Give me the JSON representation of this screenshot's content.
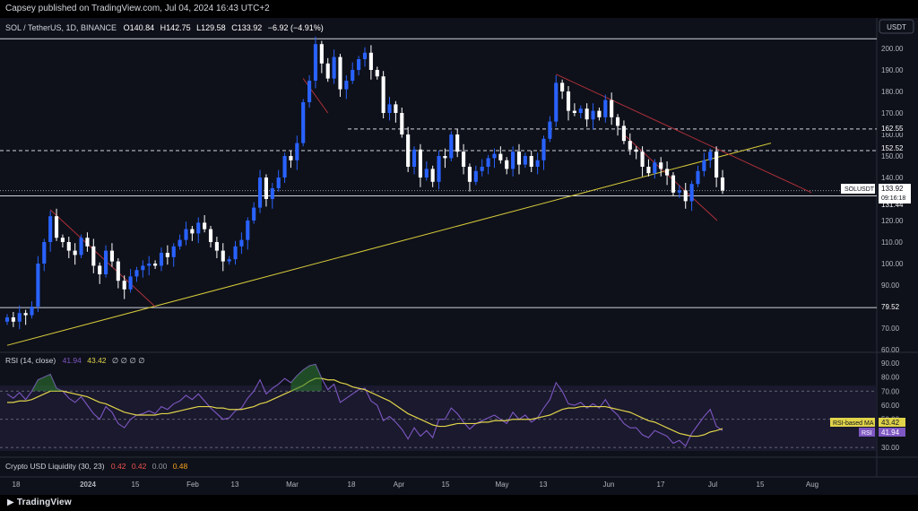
{
  "header": {
    "published": "Capsey published on TradingView.com, Jul 04, 2024 16:43 UTC+2"
  },
  "symbol_line": {
    "title": "SOL / TetherUS, 1D, BINANCE",
    "open": "O140.84",
    "high": "H142.75",
    "low": "L129.58",
    "close": "C133.92",
    "change": "−6.92 (−4.91%)"
  },
  "currency": "USDT",
  "price_axis": [
    "200.00",
    "190.00",
    "180.00",
    "170.00",
    "160.00",
    "150.00",
    "140.00",
    "130.00",
    "120.00",
    "110.00",
    "100.00",
    "90.00",
    "80.00",
    "70.00",
    "60.00"
  ],
  "level_labels": {
    "high": "162.55",
    "mid": "152.52",
    "current": "133.92",
    "countdown": "09:16:18",
    "support": "131.44",
    "bottom": "79.52",
    "symbol": "SOLUSDT"
  },
  "rsi_panel": {
    "title": "RSI (14, close)",
    "rsi_value": "41.94",
    "ma_value": "43.42",
    "extra": "∅ ∅ ∅ ∅",
    "axis": [
      "90.00",
      "80.00",
      "70.00",
      "60.00",
      "50.00",
      "40.00",
      "30.00"
    ],
    "ma_label": "RSI-based MA",
    "rsi_label": "RSI"
  },
  "liquidity_panel": {
    "title": "Crypto USD Liquidity (30, 23)",
    "v1": "0.42",
    "v2": "0.42",
    "v3": "0.00",
    "v4": "0.48"
  },
  "time_axis": [
    "18",
    "2024",
    "15",
    "Feb",
    "13",
    "Mar",
    "18",
    "Apr",
    "15",
    "May",
    "13",
    "Jun",
    "17",
    "Jul",
    "15",
    "Aug"
  ],
  "footer": {
    "brand": "TradingView"
  },
  "colors": {
    "up": "#2962ff",
    "down": "#ffffff",
    "rsi": "#7e57c2",
    "ma": "#e0d34a",
    "trend": "#d4c83a",
    "red_trend": "#b0303a"
  },
  "chart_data": [
    {
      "type": "candlestick",
      "title": "SOL / TetherUS, 1D, BINANCE",
      "ylim": [
        60,
        205
      ],
      "y_ticks": [
        200,
        190,
        180,
        170,
        160,
        150,
        140,
        130,
        120,
        110,
        100,
        90,
        80,
        70,
        60
      ],
      "horizontal_levels": [
        204.5,
        162.55,
        152.52,
        133.92,
        131.44,
        79.52
      ],
      "closes": [
        75,
        73,
        77,
        76,
        80,
        100,
        110,
        122,
        112,
        110,
        106,
        104,
        112,
        108,
        99,
        95,
        106,
        101,
        92,
        88,
        94,
        97,
        99,
        100,
        99,
        105,
        103,
        108,
        111,
        116,
        114,
        119,
        116,
        110,
        106,
        101,
        102,
        108,
        111,
        120,
        126,
        140,
        130,
        135,
        140,
        150,
        148,
        156,
        175,
        185,
        202,
        193,
        186,
        196,
        181,
        185,
        190,
        195,
        198,
        190,
        187,
        170,
        174,
        170,
        160,
        145,
        153,
        140,
        144,
        138,
        150,
        149,
        160,
        152,
        145,
        138,
        143,
        145,
        149,
        151,
        148,
        144,
        152,
        146,
        150,
        145,
        148,
        158,
        166,
        184,
        180,
        171,
        170,
        172,
        167,
        171,
        168,
        176,
        168,
        164,
        157,
        153,
        152,
        145,
        142,
        147,
        144,
        141,
        133,
        134,
        129,
        137,
        143,
        148,
        152,
        140,
        133.92
      ],
      "trendline_yellow": {
        "from": [
          0,
          62
        ],
        "to": [
          121,
          156
        ]
      }
    },
    {
      "type": "line",
      "title": "RSI (14, close)",
      "ylim": [
        25,
        95
      ],
      "y_ticks": [
        90,
        80,
        70,
        60,
        50,
        40,
        30
      ],
      "series": [
        {
          "name": "RSI",
          "values": [
            68,
            65,
            69,
            64,
            70,
            78,
            80,
            82,
            72,
            70,
            65,
            62,
            66,
            60,
            54,
            50,
            59,
            55,
            47,
            44,
            50,
            53,
            54,
            56,
            54,
            59,
            57,
            61,
            63,
            67,
            64,
            68,
            63,
            58,
            54,
            50,
            51,
            56,
            58,
            65,
            70,
            78,
            68,
            72,
            75,
            79,
            76,
            81,
            85,
            88,
            89,
            79,
            71,
            75,
            62,
            65,
            68,
            71,
            72,
            63,
            60,
            49,
            52,
            48,
            43,
            36,
            44,
            38,
            42,
            37,
            50,
            50,
            58,
            54,
            48,
            43,
            47,
            49,
            51,
            53,
            50,
            47,
            55,
            50,
            53,
            48,
            51,
            58,
            64,
            76,
            70,
            61,
            60,
            62,
            58,
            61,
            58,
            64,
            57,
            53,
            47,
            44,
            44,
            39,
            37,
            42,
            40,
            38,
            33,
            35,
            31,
            40,
            46,
            52,
            57,
            45,
            41.94
          ]
        },
        {
          "name": "RSI-based MA",
          "values": [
            62,
            62,
            63,
            63,
            64,
            66,
            68,
            70,
            70,
            70,
            69,
            68,
            67,
            66,
            64,
            62,
            61,
            59,
            57,
            55,
            54,
            53,
            53,
            53,
            53,
            54,
            54,
            55,
            56,
            57,
            58,
            59,
            59,
            59,
            58,
            58,
            57,
            57,
            57,
            58,
            59,
            61,
            62,
            64,
            66,
            68,
            70,
            72,
            74,
            77,
            79,
            79,
            78,
            78,
            76,
            75,
            73,
            72,
            71,
            69,
            67,
            65,
            63,
            60,
            57,
            54,
            52,
            50,
            48,
            46,
            45,
            45,
            46,
            47,
            47,
            47,
            47,
            48,
            48,
            49,
            49,
            49,
            50,
            50,
            50,
            50,
            51,
            52,
            53,
            55,
            57,
            58,
            58,
            59,
            59,
            59,
            59,
            59,
            58,
            57,
            56,
            55,
            53,
            51,
            49,
            48,
            46,
            44,
            42,
            40,
            39,
            38,
            38,
            39,
            41,
            42,
            43.42
          ]
        }
      ],
      "bands": [
        30,
        50,
        70
      ]
    }
  ]
}
